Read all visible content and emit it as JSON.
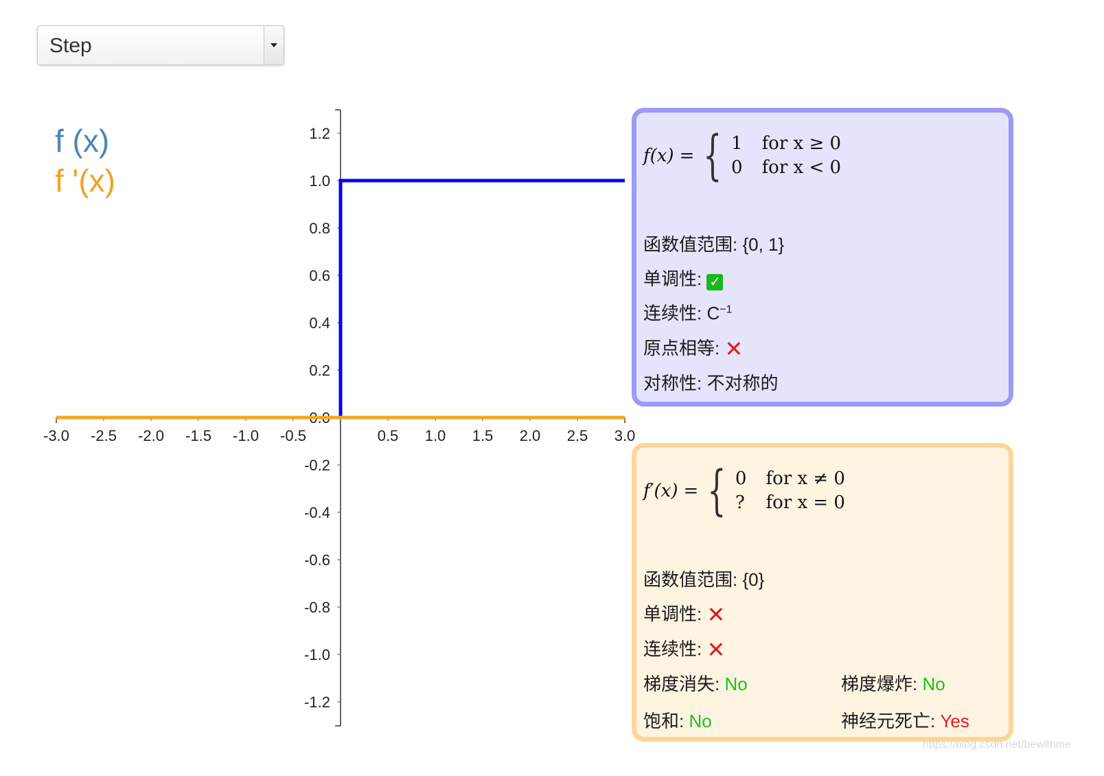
{
  "dropdown": {
    "selected": "Step"
  },
  "legend": {
    "fx": "f (x)",
    "dfx": "f '(x)"
  },
  "colors": {
    "f": "#0000ff",
    "df": "#f5a623",
    "legend_f": "#4a86b8",
    "legend_df": "#f2a128",
    "green": "#17c41c",
    "red": "#e31c1c"
  },
  "chart_data": {
    "type": "line",
    "xlim": [
      -3.0,
      3.0
    ],
    "ylim": [
      -1.25,
      1.25
    ],
    "x_ticks": [
      "-3.0",
      "-2.5",
      "-2.0",
      "-1.5",
      "-1.0",
      "-0.5",
      "0.5",
      "1.0",
      "1.5",
      "2.0",
      "2.5",
      "3.0"
    ],
    "x_tick_values": [
      -3.0,
      -2.5,
      -2.0,
      -1.5,
      -1.0,
      -0.5,
      0.5,
      1.0,
      1.5,
      2.0,
      2.5,
      3.0
    ],
    "y_ticks": [
      "1.2",
      "1.0",
      "0.8",
      "0.6",
      "0.4",
      "0.2",
      "0.0",
      "-0.2",
      "-0.4",
      "-0.6",
      "-0.8",
      "-1.0",
      "-1.2"
    ],
    "y_tick_values": [
      1.2,
      1.0,
      0.8,
      0.6,
      0.4,
      0.2,
      0.0,
      -0.2,
      -0.4,
      -0.6,
      -0.8,
      -1.0,
      -1.2
    ],
    "series": [
      {
        "name": "f (x)",
        "points": [
          [
            -3.0,
            0
          ],
          [
            0,
            0
          ],
          [
            0,
            1
          ],
          [
            3.0,
            1
          ]
        ]
      },
      {
        "name": "f '(x)",
        "points": [
          [
            -3.0,
            0
          ],
          [
            3.0,
            0
          ]
        ]
      }
    ]
  },
  "f_box": {
    "lhs": "f(x)",
    "eq": "=",
    "cases": [
      [
        "1",
        "for x ≥ 0"
      ],
      [
        "0",
        "for x < 0"
      ]
    ],
    "range_label": "函数值范围:",
    "range_value": "{0, 1}",
    "monotonic_label": "单调性:",
    "monotonic_value": "✓",
    "continuity_label": "连续性:",
    "continuity_value": "C",
    "continuity_sup": "−1",
    "origin_label": "原点相等:",
    "origin_value": "✕",
    "symmetry_label": "对称性:",
    "symmetry_value": "不对称的"
  },
  "df_box": {
    "lhs": "f′(x)",
    "eq": "=",
    "cases": [
      [
        "0",
        "for x ≠ 0"
      ],
      [
        "?",
        "for x = 0"
      ]
    ],
    "range_label": "函数值范围:",
    "range_value": "{0}",
    "monotonic_label": "单调性:",
    "monotonic_value": "✕",
    "continuity_label": "连续性:",
    "continuity_value": "✕",
    "vanishing_label": "梯度消失:",
    "vanishing_value": "No",
    "exploding_label": "梯度爆炸:",
    "exploding_value": "No",
    "saturation_label": "饱和:",
    "saturation_value": "No",
    "dead_label": "神经元死亡:",
    "dead_value": "Yes"
  },
  "watermark": "https://blog.csdn.net/bewithme"
}
